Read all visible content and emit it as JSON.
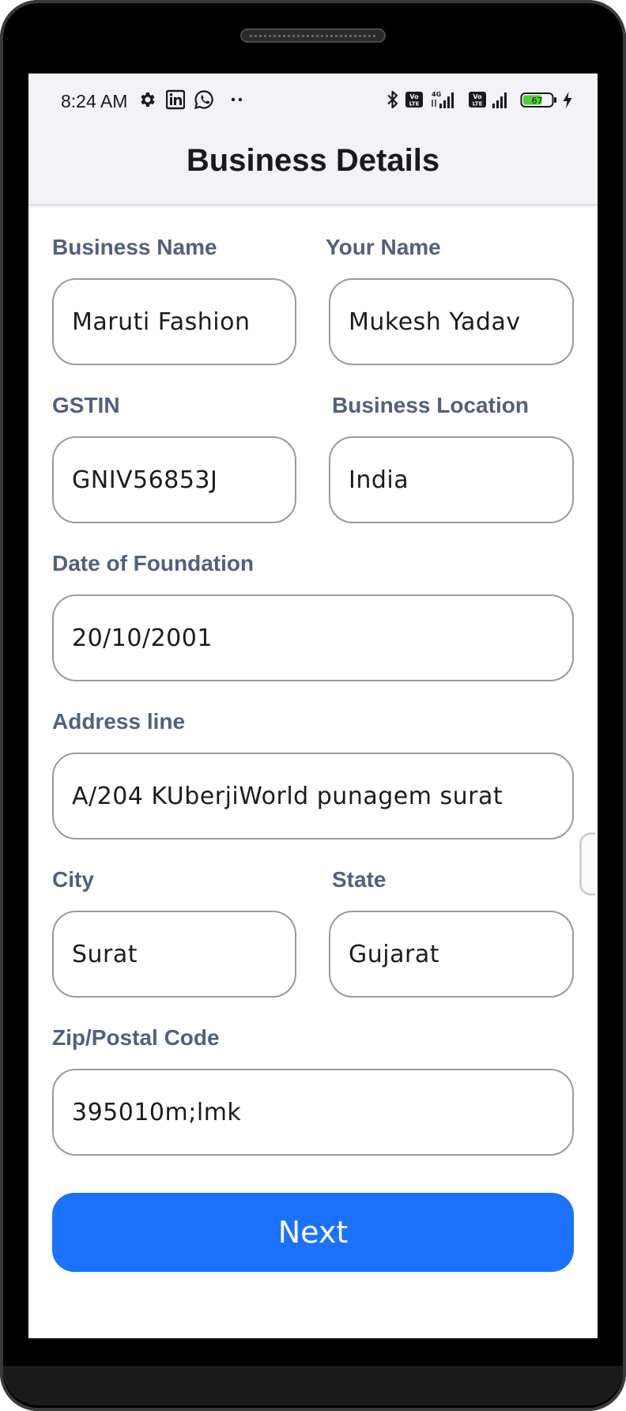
{
  "status_bar": {
    "time": "8:24 AM",
    "battery": "67",
    "icons": [
      "settings-icon",
      "linkedin-icon",
      "whatsapp-icon",
      "more-dots-icon",
      "bluetooth-icon",
      "volte-icon",
      "signal-4g-icon",
      "signal-icon",
      "battery-icon",
      "charging-icon"
    ]
  },
  "header": {
    "title": "Business Details"
  },
  "form": {
    "business_name": {
      "label": "Business Name",
      "value": "Maruti Fashion"
    },
    "your_name": {
      "label": "Your Name",
      "value": "Mukesh Yadav"
    },
    "gstin": {
      "label": "GSTIN",
      "value": "GNIV56853J"
    },
    "business_location": {
      "label": "Business Location",
      "value": "India"
    },
    "date_of_foundation": {
      "label": "Date of Foundation",
      "value": "20/10/2001"
    },
    "address_line": {
      "label": "Address line",
      "value": "A/204 KUberjiWorld punagem surat"
    },
    "city": {
      "label": "City",
      "value": "Surat"
    },
    "state": {
      "label": "State",
      "value": "Gujarat"
    },
    "zip": {
      "label": "Zip/Postal Code",
      "value": "395010m;lmk"
    }
  },
  "actions": {
    "next_label": "Next"
  },
  "colors": {
    "accent": "#1a72ff",
    "label": "#52607f",
    "appbar_bg": "#f2f2f7",
    "battery_fill": "#4cd137"
  }
}
